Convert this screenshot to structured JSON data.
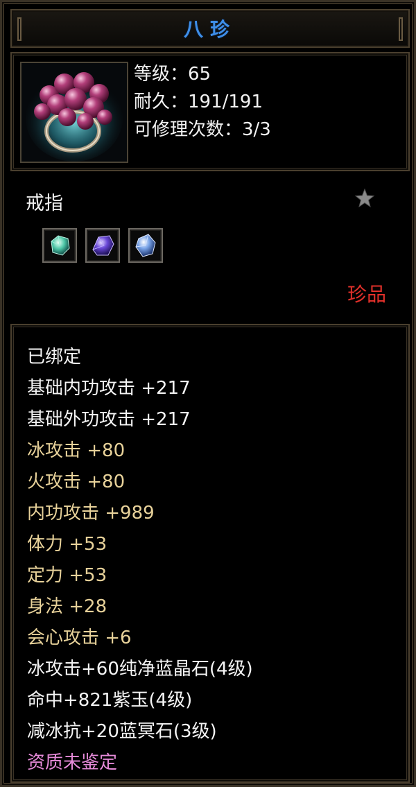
{
  "item": {
    "name": "八珍",
    "level": "等级：65",
    "durability": "耐久：191/191",
    "repair_count": "可修理次数：3/3",
    "type": "戒指",
    "quality": "珍品",
    "icon": "ring-of-purple-pearls-icon",
    "gem_slots": [
      "green-crystal-gem-icon",
      "purple-jade-gem-icon",
      "blue-crystal-gem-icon"
    ]
  },
  "attributes": [
    {
      "text": "已绑定",
      "color": "#f4f4f4"
    },
    {
      "text": "基础内功攻击 +217",
      "color": "#f4f4f4"
    },
    {
      "text": "基础外功攻击 +217",
      "color": "#f4f4f4"
    },
    {
      "text": "冰攻击 +80",
      "color": "#e8d29a"
    },
    {
      "text": "火攻击 +80",
      "color": "#e8d29a"
    },
    {
      "text": "内功攻击 +989",
      "color": "#e8d29a"
    },
    {
      "text": "体力 +53",
      "color": "#e8d29a"
    },
    {
      "text": "定力 +53",
      "color": "#e8d29a"
    },
    {
      "text": "身法 +28",
      "color": "#e8d29a"
    },
    {
      "text": "会心攻击 +6",
      "color": "#e8d29a"
    },
    {
      "text": "冰攻击+60纯净蓝晶石(4级)",
      "color": "#f4f4f4"
    },
    {
      "text": "命中+821紫玉(4级)",
      "color": "#f4f4f4"
    },
    {
      "text": "减冰抗+20蓝冥石(3级)",
      "color": "#f4f4f4"
    },
    {
      "text": "资质未鉴定",
      "color": "#e58ad8"
    }
  ],
  "colors": {
    "title": "#3e8ee8",
    "quality": "#e0302a",
    "frame": "#4a3f2e"
  }
}
